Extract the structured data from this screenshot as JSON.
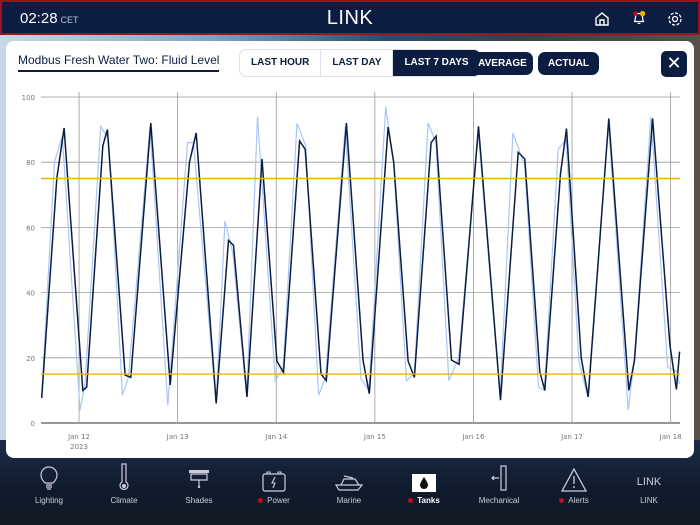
{
  "header": {
    "time": "02:28",
    "timezone": "CET",
    "title": "LINK"
  },
  "panel": {
    "title": "Modbus Fresh Water Two: Fluid Level",
    "ranges": [
      {
        "label": "LAST HOUR",
        "active": false
      },
      {
        "label": "LAST DAY",
        "active": false
      },
      {
        "label": "LAST 7 DAYS",
        "active": true
      }
    ],
    "average_label": "AVERAGE",
    "actual_label": "ACTUAL",
    "close_label": "✕"
  },
  "chart_data": {
    "type": "line",
    "title": "Modbus Fresh Water Two: Fluid Level",
    "xlabel": "",
    "ylabel": "",
    "ylim": [
      0,
      100
    ],
    "yticks": [
      0,
      20,
      40,
      60,
      80,
      100
    ],
    "xlim_days_from_jan12": [
      -0.386,
      6.095
    ],
    "xticks": [
      {
        "day": 0,
        "label": "Jan 12",
        "sub": "2023"
      },
      {
        "day": 1,
        "label": "Jan 13"
      },
      {
        "day": 2,
        "label": "Jan 14"
      },
      {
        "day": 3,
        "label": "Jan 15"
      },
      {
        "day": 4,
        "label": "Jan 16"
      },
      {
        "day": 5,
        "label": "Jan 17"
      },
      {
        "day": 6,
        "label": "Jan 18"
      }
    ],
    "grid": true,
    "thresholds": [
      {
        "value": 75,
        "color": "#f0b400"
      },
      {
        "value": 15,
        "color": "#f0b400"
      }
    ],
    "series": [
      {
        "name": "Average",
        "color": "#0b1d40",
        "x": [
          -0.379,
          -0.226,
          -0.152,
          0.038,
          0.078,
          0.241,
          0.287,
          0.467,
          0.525,
          0.728,
          0.924,
          1.12,
          1.188,
          1.391,
          1.516,
          1.566,
          1.703,
          1.855,
          2.007,
          2.074,
          2.237,
          2.294,
          2.454,
          2.508,
          2.711,
          2.88,
          2.944,
          3.134,
          3.191,
          3.337,
          3.401,
          3.571,
          3.621,
          3.777,
          3.855,
          4.051,
          4.274,
          4.454,
          4.521,
          4.673,
          4.724,
          4.883,
          4.944,
          5.093,
          5.164,
          5.373,
          5.576,
          5.634,
          5.817,
          5.993,
          6.058,
          6.091
        ],
        "y": [
          7.7,
          75,
          90.5,
          10,
          11,
          85,
          90,
          14.7,
          14,
          92,
          11.7,
          80,
          89,
          6,
          56,
          54.5,
          8,
          81,
          19,
          15.5,
          86.5,
          84,
          15,
          13,
          92,
          19.3,
          9,
          90.8,
          80,
          19,
          14,
          86,
          88,
          19.3,
          18,
          91,
          7,
          83,
          81,
          15.7,
          10,
          76.5,
          90.3,
          20,
          8,
          93.4,
          10,
          19.3,
          93.4,
          24,
          10.3,
          21.9
        ]
      },
      {
        "name": "Actual",
        "color": "#a9c6f5",
        "x": [
          -0.379,
          -0.25,
          -0.17,
          0.01,
          0.06,
          0.22,
          0.3,
          0.44,
          0.5,
          0.72,
          0.9,
          1.1,
          1.16,
          1.39,
          1.48,
          1.56,
          1.7,
          1.81,
          1.99,
          2.07,
          2.21,
          2.3,
          2.43,
          2.5,
          2.7,
          2.86,
          2.94,
          3.11,
          3.19,
          3.32,
          3.4,
          3.54,
          3.62,
          3.75,
          3.85,
          4.05,
          4.27,
          4.4,
          4.52,
          4.66,
          4.72,
          4.86,
          4.94,
          5.07,
          5.16,
          5.37,
          5.57,
          5.63,
          5.8,
          5.97,
          6.06,
          6.09
        ],
        "y": [
          8,
          80,
          88,
          4,
          12,
          91,
          87,
          8.5,
          14,
          91,
          5.5,
          86,
          86,
          6,
          62,
          52,
          8,
          94,
          13,
          17,
          92,
          85,
          8.5,
          14,
          91,
          13.5,
          10,
          97,
          80,
          13,
          15,
          92,
          86,
          13,
          20,
          89,
          8,
          89,
          79,
          11,
          10,
          84,
          87,
          19,
          8,
          92,
          4,
          19,
          94,
          17,
          16,
          12
        ]
      }
    ]
  },
  "nav": [
    {
      "label": "Lighting",
      "icon": "lightbulb-icon",
      "alert": false,
      "selected": false
    },
    {
      "label": "Climate",
      "icon": "thermometer-icon",
      "alert": false,
      "selected": false
    },
    {
      "label": "Shades",
      "icon": "shades-icon",
      "alert": false,
      "selected": false
    },
    {
      "label": "Power",
      "icon": "battery-icon",
      "alert": true,
      "selected": false
    },
    {
      "label": "Marine",
      "icon": "yacht-icon",
      "alert": false,
      "selected": false
    },
    {
      "label": "Tanks",
      "icon": "water-drop-icon",
      "alert": true,
      "selected": true
    },
    {
      "label": "Mechanical",
      "icon": "door-icon",
      "alert": false,
      "selected": false
    },
    {
      "label": "Alerts",
      "icon": "warning-icon",
      "alert": true,
      "selected": false
    },
    {
      "label": "LINK",
      "icon": "link-text-icon",
      "alert": false,
      "selected": false,
      "icon_text": "LINK"
    }
  ],
  "colors": {
    "navy": "#0b1d40",
    "alert_red": "#b3121e",
    "threshold": "#f0b400",
    "notification_yellow": "#f0b400"
  }
}
